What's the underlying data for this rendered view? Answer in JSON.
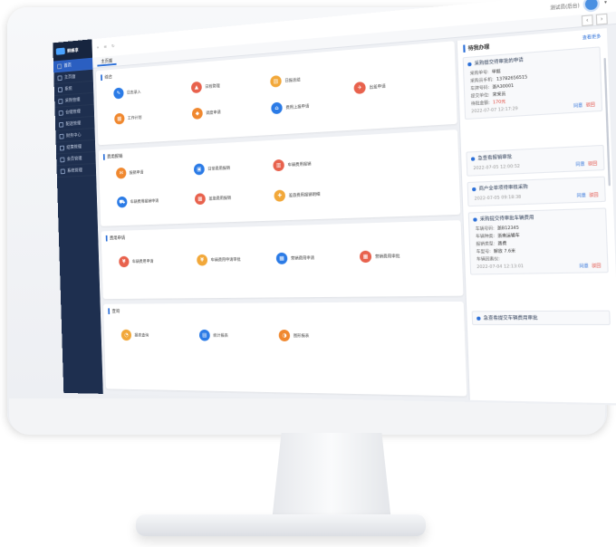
{
  "app": {
    "name": "鲜蜂享"
  },
  "header": {
    "ctrl_back": "«",
    "ctrl_menu": "≡",
    "ctrl_refresh": "↻",
    "user_name": "测试员(后台)",
    "user_arrow": "▾"
  },
  "tabs": {
    "home": "主页面",
    "prev": "‹",
    "next": "›"
  },
  "sidebar": {
    "items": [
      {
        "label": "首页"
      },
      {
        "label": "主页面"
      },
      {
        "label": "系统"
      },
      {
        "label": "采购管理"
      },
      {
        "label": "仓储管理"
      },
      {
        "label": "配送管理"
      },
      {
        "label": "财务中心"
      },
      {
        "label": "结算管理"
      },
      {
        "label": "会员管理"
      },
      {
        "label": "系统管理"
      }
    ]
  },
  "sections": {
    "s1": {
      "title": "综合"
    },
    "s2": {
      "title": "费用报销"
    },
    "s3": {
      "title": "费用申请"
    },
    "s4": {
      "title": "查询"
    }
  },
  "apps": {
    "a1": {
      "label": "日志录入",
      "glyph": "✎"
    },
    "a2": {
      "label": "日程管理",
      "glyph": "▲"
    },
    "a3": {
      "label": "日报总结",
      "glyph": "▤"
    },
    "a4": {
      "label": "工作计划",
      "glyph": "▦"
    },
    "a5": {
      "label": "调度申请",
      "glyph": "◆"
    },
    "a6": {
      "label": "费用上报申请",
      "glyph": "⌂"
    },
    "a7": {
      "label": "出差申请",
      "glyph": "✈"
    },
    "a8": {
      "label": "报销申请",
      "glyph": "✉"
    },
    "a9": {
      "label": "日常费用报销",
      "glyph": "▣"
    },
    "a10": {
      "label": "车辆费用报销",
      "glyph": "▥"
    },
    "a11": {
      "label": "车辆费用报销申请",
      "glyph": "⛟"
    },
    "a12": {
      "label": "差旅费用报销",
      "glyph": "▩"
    },
    "a13": {
      "label": "差旅费用报销明细",
      "glyph": "✚"
    },
    "a14": {
      "label": "车辆费用申请",
      "glyph": "¥"
    },
    "a15": {
      "label": "车辆费用申请审批",
      "glyph": "¥"
    },
    "a16": {
      "label": "营销费用申请",
      "glyph": "▦"
    },
    "a17": {
      "label": "营销费用审批",
      "glyph": "▦"
    },
    "a18": {
      "label": "报表查询",
      "glyph": "◔"
    },
    "a19": {
      "label": "统计报表",
      "glyph": "▤"
    },
    "a20": {
      "label": "图形报表",
      "glyph": "◑"
    }
  },
  "colors": {
    "orange": "#f0882f",
    "blue": "#2b7be6",
    "red": "#e8624d",
    "yellow": "#f2a83a"
  },
  "right": {
    "title": "待我办理",
    "more": "查看更多",
    "todo1": {
      "title": "采购提交待审批的申请",
      "rows": [
        {
          "k": "采购单号:",
          "v": "单据"
        },
        {
          "k": "采购员手机:",
          "v": "13782656515"
        },
        {
          "k": "车牌号码:",
          "v": "浙A30001"
        },
        {
          "k": "提交单位:",
          "v": "宋采员"
        },
        {
          "k": "待批金额:",
          "v": "170元"
        }
      ],
      "time": "2022-07-07 12:17:29",
      "act1": "同意",
      "act2": "驳回"
    },
    "todo2": {
      "title": "急查看报销审批",
      "time": "2022-07-05 12:00:52",
      "act1": "同意",
      "act2": "驳回"
    },
    "todo3": {
      "title": "商户全单项待审核采购",
      "time": "2022-07-05 09:18:38",
      "act1": "同意",
      "act2": "驳回"
    },
    "todo4": {
      "title": "采购提交待审批车辆费用",
      "rows": [
        {
          "k": "车辆号码:",
          "v": "浙B12345"
        },
        {
          "k": "车辆种类:",
          "v": "浙南运输车"
        },
        {
          "k": "报销类型:",
          "v": "路费"
        },
        {
          "k": "车型号:",
          "v": "解放 7.6米"
        },
        {
          "k": "车辆因素仪:",
          "v": ""
        }
      ],
      "time": "2022-07-04 12:13:01",
      "act1": "同意",
      "act2": "驳回"
    },
    "todo5": {
      "title": "急查看提交车辆费用审批"
    }
  }
}
